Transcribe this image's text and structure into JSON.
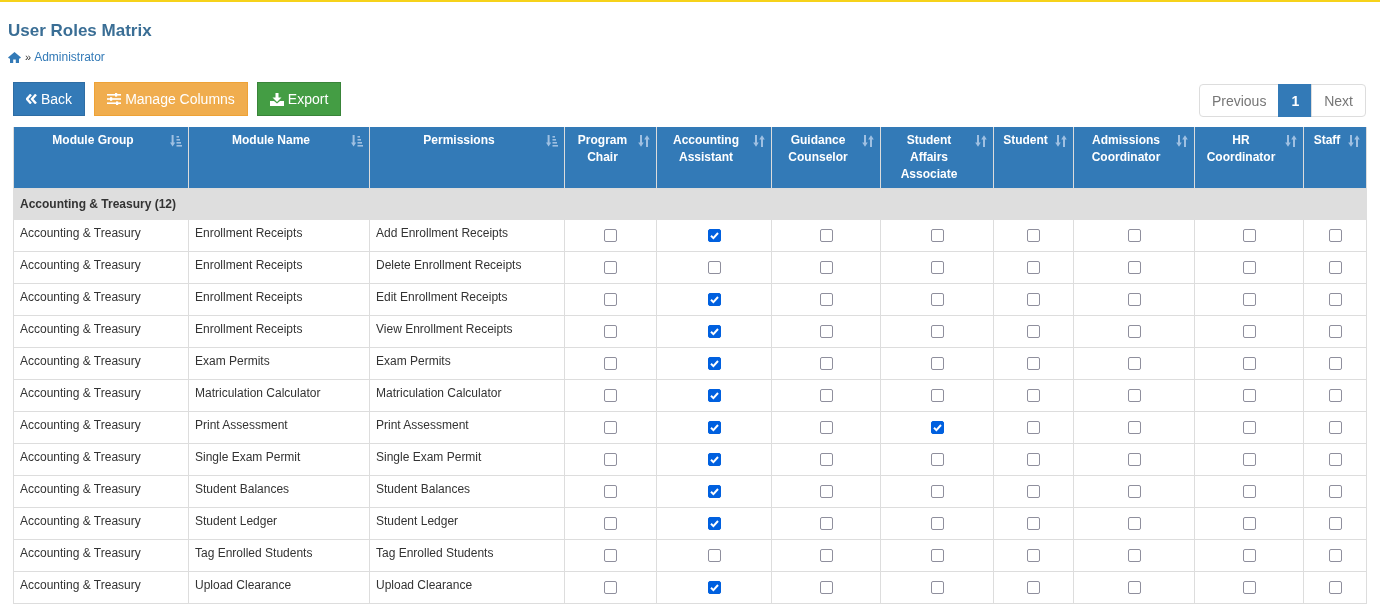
{
  "page": {
    "title": "User Roles Matrix"
  },
  "breadcrumb": {
    "separator": "»",
    "current": "Administrator"
  },
  "toolbar": {
    "buttons": [
      {
        "label": "Back",
        "kind": "back"
      },
      {
        "label": "Manage Columns",
        "kind": "columns"
      },
      {
        "label": "Export",
        "kind": "export"
      }
    ]
  },
  "pagination": [
    {
      "label": "Previous",
      "selected": false
    },
    {
      "label": "1",
      "selected": true
    },
    {
      "label": "Next",
      "selected": false
    }
  ],
  "table": {
    "columns": [
      {
        "label": "Module Group",
        "kind": "text"
      },
      {
        "label": "Module Name",
        "kind": "text"
      },
      {
        "label": "Permissions",
        "kind": "text"
      },
      {
        "label": "Program Chair",
        "kind": "role"
      },
      {
        "label": "Accounting Assistant",
        "kind": "role"
      },
      {
        "label": "Guidance Counselor",
        "kind": "role"
      },
      {
        "label": "Student Affairs Associate",
        "kind": "role"
      },
      {
        "label": "Student",
        "kind": "role"
      },
      {
        "label": "Admissions Coordinator",
        "kind": "role"
      },
      {
        "label": "HR Coordinator",
        "kind": "role"
      },
      {
        "label": "Staff",
        "kind": "role"
      }
    ],
    "groups": [
      {
        "label": "Accounting & Treasury (12)",
        "rows": [
          {
            "module_group": "Accounting & Treasury",
            "module_name": "Enrollment Receipts",
            "permission": "Add Enrollment Receipts",
            "roles": [
              {
                "checked": false
              },
              {
                "checked": true
              },
              {
                "checked": false
              },
              {
                "checked": false
              },
              {
                "checked": false
              },
              {
                "checked": false
              },
              {
                "checked": false
              },
              {
                "checked": false
              }
            ]
          },
          {
            "module_group": "Accounting & Treasury",
            "module_name": "Enrollment Receipts",
            "permission": "Delete Enrollment Receipts",
            "roles": [
              {
                "checked": false
              },
              {
                "checked": false
              },
              {
                "checked": false
              },
              {
                "checked": false
              },
              {
                "checked": false
              },
              {
                "checked": false
              },
              {
                "checked": false
              },
              {
                "checked": false
              }
            ]
          },
          {
            "module_group": "Accounting & Treasury",
            "module_name": "Enrollment Receipts",
            "permission": "Edit Enrollment Receipts",
            "roles": [
              {
                "checked": false
              },
              {
                "checked": true
              },
              {
                "checked": false
              },
              {
                "checked": false
              },
              {
                "checked": false
              },
              {
                "checked": false
              },
              {
                "checked": false
              },
              {
                "checked": false
              }
            ]
          },
          {
            "module_group": "Accounting & Treasury",
            "module_name": "Enrollment Receipts",
            "permission": "View Enrollment Receipts",
            "roles": [
              {
                "checked": false
              },
              {
                "checked": true
              },
              {
                "checked": false
              },
              {
                "checked": false
              },
              {
                "checked": false
              },
              {
                "checked": false
              },
              {
                "checked": false
              },
              {
                "checked": false
              }
            ]
          },
          {
            "module_group": "Accounting & Treasury",
            "module_name": "Exam Permits",
            "permission": "Exam Permits",
            "roles": [
              {
                "checked": false
              },
              {
                "checked": true
              },
              {
                "checked": false
              },
              {
                "checked": false
              },
              {
                "checked": false
              },
              {
                "checked": false
              },
              {
                "checked": false
              },
              {
                "checked": false
              }
            ]
          },
          {
            "module_group": "Accounting & Treasury",
            "module_name": "Matriculation Calculator",
            "permission": "Matriculation Calculator",
            "roles": [
              {
                "checked": false
              },
              {
                "checked": true
              },
              {
                "checked": false
              },
              {
                "checked": false
              },
              {
                "checked": false
              },
              {
                "checked": false
              },
              {
                "checked": false
              },
              {
                "checked": false
              }
            ]
          },
          {
            "module_group": "Accounting & Treasury",
            "module_name": "Print Assessment",
            "permission": "Print Assessment",
            "roles": [
              {
                "checked": false
              },
              {
                "checked": true
              },
              {
                "checked": false
              },
              {
                "checked": true
              },
              {
                "checked": false
              },
              {
                "checked": false
              },
              {
                "checked": false
              },
              {
                "checked": false
              }
            ]
          },
          {
            "module_group": "Accounting & Treasury",
            "module_name": "Single Exam Permit",
            "permission": "Single Exam Permit",
            "roles": [
              {
                "checked": false
              },
              {
                "checked": true
              },
              {
                "checked": false
              },
              {
                "checked": false
              },
              {
                "checked": false
              },
              {
                "checked": false
              },
              {
                "checked": false
              },
              {
                "checked": false
              }
            ]
          },
          {
            "module_group": "Accounting & Treasury",
            "module_name": "Student Balances",
            "permission": "Student Balances",
            "roles": [
              {
                "checked": false
              },
              {
                "checked": true
              },
              {
                "checked": false
              },
              {
                "checked": false
              },
              {
                "checked": false
              },
              {
                "checked": false
              },
              {
                "checked": false
              },
              {
                "checked": false
              }
            ]
          },
          {
            "module_group": "Accounting & Treasury",
            "module_name": "Student Ledger",
            "permission": "Student Ledger",
            "roles": [
              {
                "checked": false
              },
              {
                "checked": true
              },
              {
                "checked": false
              },
              {
                "checked": false
              },
              {
                "checked": false
              },
              {
                "checked": false
              },
              {
                "checked": false
              },
              {
                "checked": false
              }
            ]
          },
          {
            "module_group": "Accounting & Treasury",
            "module_name": "Tag Enrolled Students",
            "permission": "Tag Enrolled Students",
            "roles": [
              {
                "checked": false
              },
              {
                "checked": false
              },
              {
                "checked": false
              },
              {
                "checked": false
              },
              {
                "checked": false
              },
              {
                "checked": false
              },
              {
                "checked": false
              },
              {
                "checked": false
              }
            ]
          },
          {
            "module_group": "Accounting & Treasury",
            "module_name": "Upload Clearance",
            "permission": "Upload Clearance",
            "roles": [
              {
                "checked": false
              },
              {
                "checked": true
              },
              {
                "checked": false
              },
              {
                "checked": false
              },
              {
                "checked": false
              },
              {
                "checked": false
              },
              {
                "checked": false
              },
              {
                "checked": false
              }
            ]
          }
        ]
      }
    ]
  }
}
